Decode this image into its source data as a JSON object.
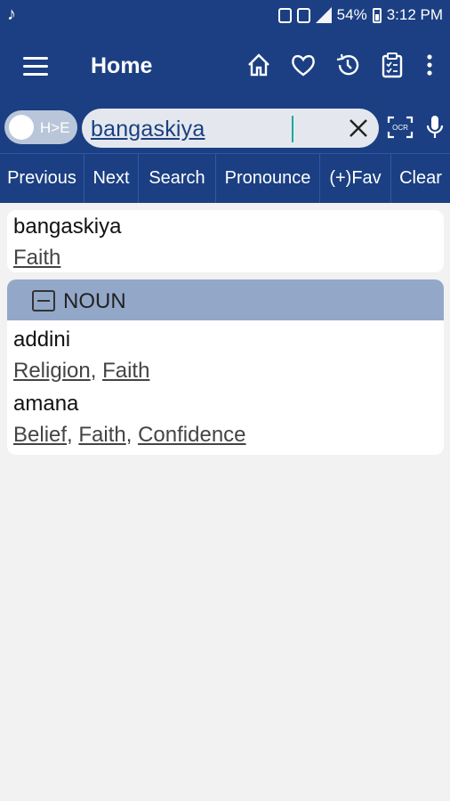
{
  "status": {
    "battery": "54%",
    "time": "3:12 PM"
  },
  "appbar": {
    "title": "Home"
  },
  "search": {
    "toggle_label": "H>E",
    "value": "bangaskiya"
  },
  "buttons": [
    "Previous",
    "Next",
    "Search",
    "Pronounce",
    "(+)Fav",
    "Clear"
  ],
  "result": {
    "word": "bangaskiya",
    "meanings": [
      "Faith"
    ]
  },
  "section": {
    "pos": "NOUN",
    "entries": [
      {
        "word": "addini",
        "meanings": [
          "Religion",
          "Faith"
        ]
      },
      {
        "word": "amana",
        "meanings": [
          "Belief",
          "Faith",
          "Confidence"
        ]
      }
    ]
  },
  "colors": {
    "primary": "#1b3f82",
    "section_header": "#93a8c9",
    "background": "#f2f2f2"
  }
}
